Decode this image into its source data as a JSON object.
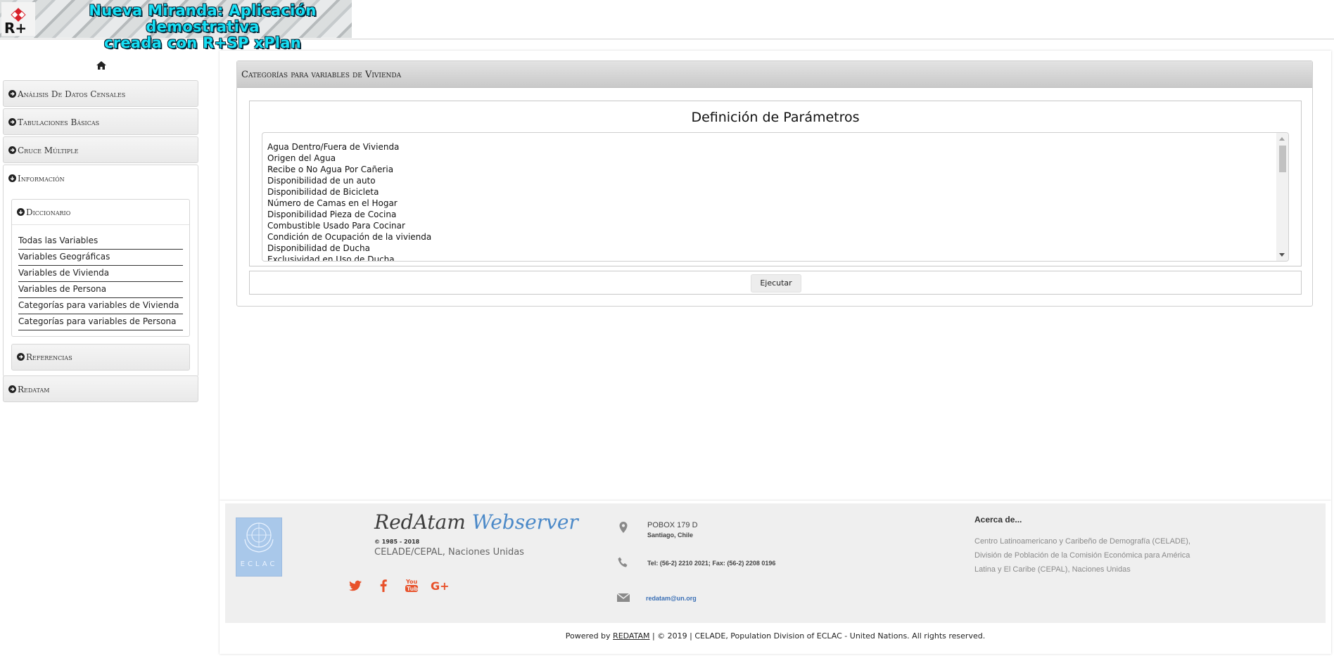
{
  "header": {
    "title_line1": "Nueva Miranda: Aplicación demostrativa",
    "title_line2": "creada con R+SP xPlan",
    "logo_text": "R+"
  },
  "sidebar": {
    "home_icon": "home-icon",
    "items": [
      {
        "label": "Análisis De Datos Censales",
        "icon": "circle-arrow-right-icon"
      },
      {
        "label": "Tabulaciones Básicas",
        "icon": "circle-arrow-right-icon"
      },
      {
        "label": "Cruce Múltiple",
        "icon": "circle-arrow-right-icon"
      },
      {
        "label": "Información",
        "icon": "circle-arrow-down-icon",
        "expanded": true
      },
      {
        "label": "Redatam",
        "icon": "circle-arrow-right-icon"
      }
    ],
    "info": {
      "dictionary": {
        "label": "Diccionario",
        "links": [
          "Todas las Variables",
          "Variables Geográficas",
          "Variables de Vivienda",
          "Variables de Persona",
          "Categorías para variables de Vivienda",
          "Categorías para variables de Persona"
        ]
      },
      "references": {
        "label": "Referencias"
      }
    }
  },
  "main": {
    "panel_title": "Categorías para variables de Vivienda",
    "params_title": "Definición de Parámetros",
    "options": [
      "Agua Dentro/Fuera de Vivienda",
      "Origen del Agua",
      "Recibe o No Agua Por Cañeria",
      "Disponibilidad de un auto",
      "Disponibilidad de Bicicleta",
      "Número de Camas en el Hogar",
      "Disponibilidad Pieza de Cocina",
      "Combustible Usado Para Cocinar",
      "Condición de Ocupación de la vivienda",
      "Disponibilidad de Ducha",
      "Exclusividad en Uso de Ducha"
    ],
    "execute_label": "Ejecutar"
  },
  "footer": {
    "brand_part1": "RedAtam",
    "brand_part2": "Webserver",
    "years": "© 1985 - 2018",
    "org": "CELADE/CEPAL, Naciones Unidas",
    "un_logo_text": "ECLAC",
    "social": [
      "twitter-icon",
      "facebook-icon",
      "youtube-icon",
      "google-plus-icon"
    ],
    "address_line1": "POBOX 179 D",
    "address_line2": "Santiago, Chile",
    "phone": "Tel: (56-2) 2210 2021; Fax: (56-2) 2208 0196",
    "email": "redatam@un.org",
    "about_title": "Acerca de...",
    "about_text": "Centro Latinoamericano y Caribeño de Demografía (CELADE), División de Población de la Comisión Económica para América Latina y El Caribe (CEPAL), Naciones Unidas",
    "powered_prefix": "Powered by",
    "powered_link": "REDATAM",
    "powered_suffix": "| © 2019 | CELADE, Population Division of ECLAC - United Nations. All rights reserved.",
    "colors": {
      "brand_blue": "#4b89c8",
      "social_orange": "#e8512a",
      "email_blue": "#3a6fb5"
    }
  }
}
